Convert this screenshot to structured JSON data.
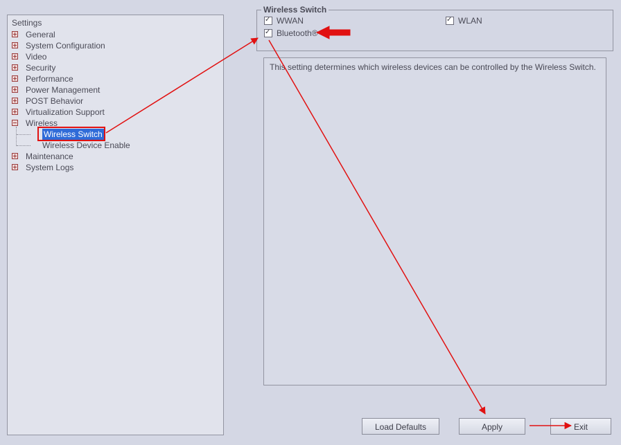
{
  "tree": {
    "title": "Settings",
    "items": [
      {
        "label": "General"
      },
      {
        "label": "System Configuration"
      },
      {
        "label": "Video"
      },
      {
        "label": "Security"
      },
      {
        "label": "Performance"
      },
      {
        "label": "Power Management"
      },
      {
        "label": "POST Behavior"
      },
      {
        "label": "Virtualization Support"
      },
      {
        "label": "Wireless",
        "children": [
          {
            "label": "Wireless Switch"
          },
          {
            "label": "Wireless Device Enable"
          }
        ]
      },
      {
        "label": "Maintenance"
      },
      {
        "label": "System Logs"
      }
    ]
  },
  "panel": {
    "legend": "Wireless Switch",
    "checkboxes": {
      "wwan": "WWAN",
      "wlan": "WLAN",
      "bluetooth": "Bluetooth®"
    },
    "description": "This setting determines which wireless devices can be controlled by the Wireless Switch."
  },
  "buttons": {
    "load_defaults": "Load Defaults",
    "apply": "Apply",
    "exit": "Exit"
  }
}
